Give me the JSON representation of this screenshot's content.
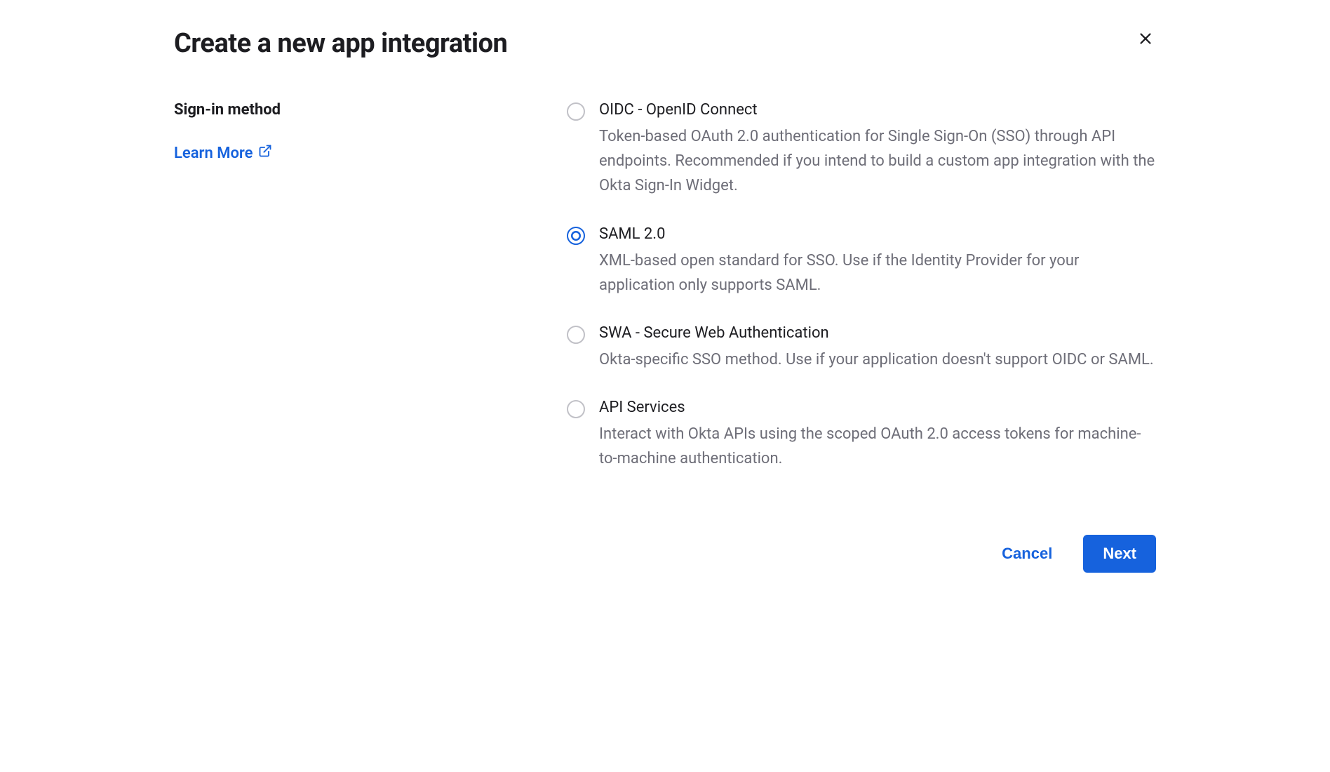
{
  "dialog": {
    "title": "Create a new app integration",
    "section_label": "Sign-in method",
    "learn_more_label": "Learn More",
    "cancel_label": "Cancel",
    "next_label": "Next"
  },
  "options": [
    {
      "title": "OIDC - OpenID Connect",
      "description": "Token-based OAuth 2.0 authentication for Single Sign-On (SSO) through API endpoints. Recommended if you intend to build a custom app integration with the Okta Sign-In Widget.",
      "selected": false
    },
    {
      "title": "SAML 2.0",
      "description": "XML-based open standard for SSO. Use if the Identity Provider for your application only supports SAML.",
      "selected": true
    },
    {
      "title": "SWA - Secure Web Authentication",
      "description": "Okta-specific SSO method. Use if your application doesn't support OIDC or SAML.",
      "selected": false
    },
    {
      "title": "API Services",
      "description": "Interact with Okta APIs using the scoped OAuth 2.0 access tokens for machine-to-machine authentication.",
      "selected": false
    }
  ]
}
